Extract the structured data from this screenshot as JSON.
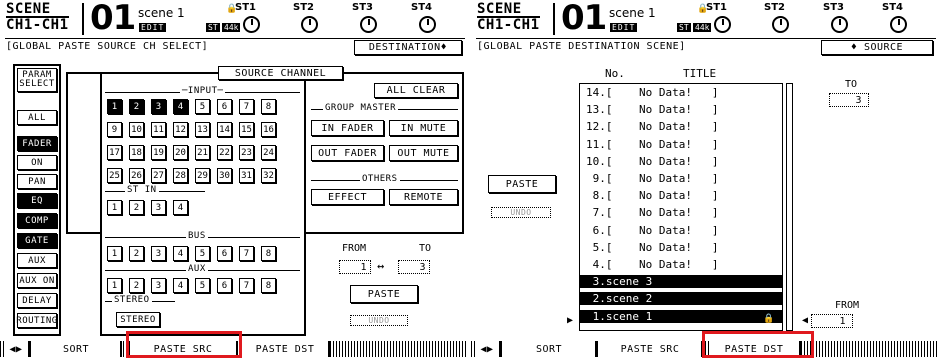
{
  "left": {
    "header": {
      "scene_label": "SCENE",
      "channel_label": "CH1-CH1",
      "scene_number": "01",
      "scene_title": "scene 1",
      "edit_badge": "EDIT",
      "st_badge": "ST",
      "fs_badge": "44k",
      "lock_icon": "lock-icon",
      "stereo_labels": [
        "ST1",
        "ST2",
        "ST3",
        "ST4"
      ]
    },
    "title_bar": {
      "title": "GLOBAL PASTE SOURCE CH SELECT",
      "destination_button": "DESTINATION♦"
    },
    "param_select": {
      "label": "PARAM SELECT",
      "buttons": [
        {
          "label": "ALL",
          "on": false
        },
        {
          "label": "FADER",
          "on": true
        },
        {
          "label": "ON",
          "on": false
        },
        {
          "label": "PAN",
          "on": false
        },
        {
          "label": "EQ",
          "on": true
        },
        {
          "label": "COMP",
          "on": true
        },
        {
          "label": "GATE",
          "on": true
        },
        {
          "label": "AUX",
          "on": false
        },
        {
          "label": "AUX ON",
          "on": false
        },
        {
          "label": "DELAY",
          "on": false
        },
        {
          "label": "ROUTING",
          "on": false
        }
      ]
    },
    "source_channel": {
      "label": "SOURCE CHANNEL",
      "input_label": "INPUT",
      "input_channels": [
        "1",
        "2",
        "3",
        "4",
        "5",
        "6",
        "7",
        "8",
        "9",
        "10",
        "11",
        "12",
        "13",
        "14",
        "15",
        "16",
        "17",
        "18",
        "19",
        "20",
        "21",
        "22",
        "23",
        "24",
        "25",
        "26",
        "27",
        "28",
        "29",
        "30",
        "31",
        "32"
      ],
      "input_selected": [
        "1",
        "2",
        "3",
        "4"
      ],
      "st_in_label": "ST IN",
      "st_in_channels": [
        "1",
        "2",
        "3",
        "4"
      ],
      "bus_label": "BUS",
      "bus_channels": [
        "1",
        "2",
        "3",
        "4",
        "5",
        "6",
        "7",
        "8"
      ],
      "aux_label": "AUX",
      "aux_channels": [
        "1",
        "2",
        "3",
        "4",
        "5",
        "6",
        "7",
        "8"
      ],
      "stereo_label": "STEREO",
      "stereo_button": "STEREO",
      "all_clear": "ALL CLEAR",
      "group_master_label": "GROUP MASTER",
      "group_buttons": [
        "IN FADER",
        "IN MUTE",
        "OUT FADER",
        "OUT MUTE"
      ],
      "others_label": "OTHERS",
      "others_buttons": [
        "EFFECT",
        "REMOTE"
      ]
    },
    "from_to": {
      "from_label": "FROM",
      "to_label": "TO",
      "from_value": "1",
      "arrow": "↔",
      "to_value": "3"
    },
    "paste_button": "PASTE",
    "undo_button": "UNDO",
    "tabs": {
      "scroll": "◀▶",
      "sort": "SORT",
      "paste_src": "PASTE SRC",
      "paste_dst": "PASTE DST"
    }
  },
  "right": {
    "header": {
      "scene_label": "SCENE",
      "channel_label": "CH1-CH1",
      "scene_number": "01",
      "scene_title": "scene 1",
      "edit_badge": "EDIT",
      "st_badge": "ST",
      "fs_badge": "44k",
      "stereo_labels": [
        "ST1",
        "ST2",
        "ST3",
        "ST4"
      ]
    },
    "title_bar": {
      "title": "GLOBAL PASTE DESTINATION SCENE",
      "source_button": "♦ SOURCE"
    },
    "columns": {
      "no": "No.",
      "title": "TITLE"
    },
    "scenes": [
      {
        "text": "14.[    No Data!   ]",
        "sel": false
      },
      {
        "text": "13.[    No Data!   ]",
        "sel": false
      },
      {
        "text": "12.[    No Data!   ]",
        "sel": false
      },
      {
        "text": "11.[    No Data!   ]",
        "sel": false
      },
      {
        "text": "10.[    No Data!   ]",
        "sel": false
      },
      {
        "text": " 9.[    No Data!   ]",
        "sel": false
      },
      {
        "text": " 8.[    No Data!   ]",
        "sel": false
      },
      {
        "text": " 7.[    No Data!   ]",
        "sel": false
      },
      {
        "text": " 6.[    No Data!   ]",
        "sel": false
      },
      {
        "text": " 5.[    No Data!   ]",
        "sel": false
      },
      {
        "text": " 4.[    No Data!   ]",
        "sel": false
      },
      {
        "text": " 3.scene 3",
        "sel": true
      },
      {
        "text": " 2.scene 2",
        "sel": true
      },
      {
        "text": " 1.scene 1",
        "sel": true
      }
    ],
    "to_label": "TO",
    "to_value": "3",
    "from_label": "FROM",
    "from_value": "1",
    "paste_button": "PASTE",
    "undo_button": "UNDO",
    "tabs": {
      "scroll": "◀▶",
      "sort": "SORT",
      "paste_src": "PASTE SRC",
      "paste_dst": "PASTE DST"
    }
  },
  "colors": {
    "highlight": "#e0191e",
    "fg": "#000000",
    "bg": "#ffffff"
  }
}
